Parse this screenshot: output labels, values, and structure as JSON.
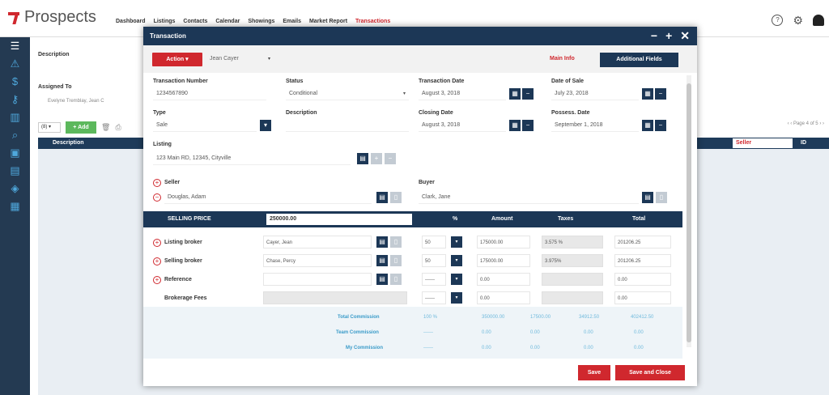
{
  "app": {
    "logo_text": "Prospects",
    "nav": [
      "Dashboard",
      "Listings",
      "Contacts",
      "Calendar",
      "Showings",
      "Emails",
      "Market Report",
      "Transactions"
    ],
    "active_nav": "Transactions"
  },
  "background": {
    "description_label": "Description",
    "assigned_to_label": "Assigned To",
    "assigned_to_value": "Evelyne Tremblay, Jean C",
    "add_label": "+ Add",
    "page_label": "Page",
    "page_value": "4",
    "of_label": "of 5",
    "col_description": "Description",
    "col_seller": "Seller",
    "col_id": "ID"
  },
  "modal": {
    "title": "Transaction",
    "action_label": "Action",
    "agent": "Jean Cayer",
    "tab_main": "Main Info",
    "tab_additional": "Additional Fields",
    "fields": {
      "transaction_number_label": "Transaction Number",
      "transaction_number": "1234567890",
      "status_label": "Status",
      "status": "Conditional",
      "transaction_date_label": "Transaction Date",
      "transaction_date": "August 3, 2018",
      "date_of_sale_label": "Date of Sale",
      "date_of_sale": "July 23, 2018",
      "type_label": "Type",
      "type": "Sale",
      "description_label": "Description",
      "closing_date_label": "Closing Date",
      "closing_date": "August 3, 2018",
      "possess_date_label": "Possess. Date",
      "possess_date": "September 1, 2018",
      "listing_label": "Listing",
      "listing": "123 Main RD, 12345, Cityville",
      "seller_label": "Seller",
      "seller": "Douglas, Adam",
      "buyer_label": "Buyer",
      "buyer": "Clark, Jane"
    },
    "price_table": {
      "selling_price_label": "SELLING PRICE",
      "selling_price": "250000.00",
      "col_percent": "%",
      "col_amount": "Amount",
      "col_taxes": "Taxes",
      "col_total": "Total",
      "rows": [
        {
          "label": "Listing broker",
          "name": "Cayer, Jean",
          "pct": "50",
          "amount": "175000.00",
          "taxes": "3.575 %",
          "total": "201206.25"
        },
        {
          "label": "Selling broker",
          "name": "Chase, Percy",
          "pct": "50",
          "amount": "175000.00",
          "taxes": "3.975%",
          "total": "201206.25"
        },
        {
          "label": "Reference",
          "name": "",
          "pct": "------",
          "amount": "0.00",
          "taxes": "",
          "total": "0.00"
        },
        {
          "label": "Brokerage Fees",
          "name": "",
          "pct": "------",
          "amount": "0.00",
          "taxes": "",
          "total": "0.00"
        }
      ]
    },
    "commission": {
      "total_label": "Total Commission",
      "team_label": "Team Commission",
      "my_label": "My Commission",
      "total_values": [
        "100 %",
        "350000.00",
        "17500.00",
        "34912.50",
        "402412.50"
      ],
      "team_values": [
        "------",
        "0.00",
        "0.00",
        "0.00",
        "0.00"
      ],
      "my_values": [
        "------",
        "0.00",
        "0.00",
        "0.00",
        "0.00"
      ]
    },
    "save_label": "Save",
    "save_close_label": "Save and Close"
  },
  "colors": {
    "brand_red": "#d0282e",
    "navy": "#1c3756",
    "sidebar": "#243a52",
    "commission_text": "#3a9bc9"
  }
}
